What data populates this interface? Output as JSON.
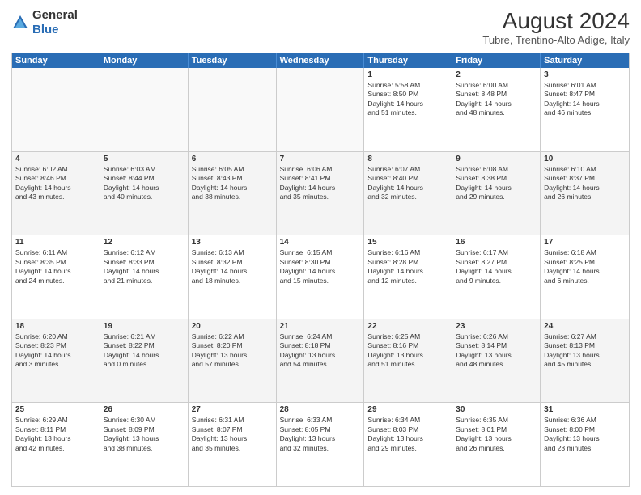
{
  "header": {
    "logo_general": "General",
    "logo_blue": "Blue",
    "month_year": "August 2024",
    "location": "Tubre, Trentino-Alto Adige, Italy"
  },
  "days_of_week": [
    "Sunday",
    "Monday",
    "Tuesday",
    "Wednesday",
    "Thursday",
    "Friday",
    "Saturday"
  ],
  "rows": [
    [
      {
        "day": "",
        "text": "",
        "empty": true
      },
      {
        "day": "",
        "text": "",
        "empty": true
      },
      {
        "day": "",
        "text": "",
        "empty": true
      },
      {
        "day": "",
        "text": "",
        "empty": true
      },
      {
        "day": "1",
        "text": "Sunrise: 5:58 AM\nSunset: 8:50 PM\nDaylight: 14 hours\nand 51 minutes."
      },
      {
        "day": "2",
        "text": "Sunrise: 6:00 AM\nSunset: 8:48 PM\nDaylight: 14 hours\nand 48 minutes."
      },
      {
        "day": "3",
        "text": "Sunrise: 6:01 AM\nSunset: 8:47 PM\nDaylight: 14 hours\nand 46 minutes."
      }
    ],
    [
      {
        "day": "4",
        "text": "Sunrise: 6:02 AM\nSunset: 8:46 PM\nDaylight: 14 hours\nand 43 minutes."
      },
      {
        "day": "5",
        "text": "Sunrise: 6:03 AM\nSunset: 8:44 PM\nDaylight: 14 hours\nand 40 minutes."
      },
      {
        "day": "6",
        "text": "Sunrise: 6:05 AM\nSunset: 8:43 PM\nDaylight: 14 hours\nand 38 minutes."
      },
      {
        "day": "7",
        "text": "Sunrise: 6:06 AM\nSunset: 8:41 PM\nDaylight: 14 hours\nand 35 minutes."
      },
      {
        "day": "8",
        "text": "Sunrise: 6:07 AM\nSunset: 8:40 PM\nDaylight: 14 hours\nand 32 minutes."
      },
      {
        "day": "9",
        "text": "Sunrise: 6:08 AM\nSunset: 8:38 PM\nDaylight: 14 hours\nand 29 minutes."
      },
      {
        "day": "10",
        "text": "Sunrise: 6:10 AM\nSunset: 8:37 PM\nDaylight: 14 hours\nand 26 minutes."
      }
    ],
    [
      {
        "day": "11",
        "text": "Sunrise: 6:11 AM\nSunset: 8:35 PM\nDaylight: 14 hours\nand 24 minutes."
      },
      {
        "day": "12",
        "text": "Sunrise: 6:12 AM\nSunset: 8:33 PM\nDaylight: 14 hours\nand 21 minutes."
      },
      {
        "day": "13",
        "text": "Sunrise: 6:13 AM\nSunset: 8:32 PM\nDaylight: 14 hours\nand 18 minutes."
      },
      {
        "day": "14",
        "text": "Sunrise: 6:15 AM\nSunset: 8:30 PM\nDaylight: 14 hours\nand 15 minutes."
      },
      {
        "day": "15",
        "text": "Sunrise: 6:16 AM\nSunset: 8:28 PM\nDaylight: 14 hours\nand 12 minutes."
      },
      {
        "day": "16",
        "text": "Sunrise: 6:17 AM\nSunset: 8:27 PM\nDaylight: 14 hours\nand 9 minutes."
      },
      {
        "day": "17",
        "text": "Sunrise: 6:18 AM\nSunset: 8:25 PM\nDaylight: 14 hours\nand 6 minutes."
      }
    ],
    [
      {
        "day": "18",
        "text": "Sunrise: 6:20 AM\nSunset: 8:23 PM\nDaylight: 14 hours\nand 3 minutes."
      },
      {
        "day": "19",
        "text": "Sunrise: 6:21 AM\nSunset: 8:22 PM\nDaylight: 14 hours\nand 0 minutes."
      },
      {
        "day": "20",
        "text": "Sunrise: 6:22 AM\nSunset: 8:20 PM\nDaylight: 13 hours\nand 57 minutes."
      },
      {
        "day": "21",
        "text": "Sunrise: 6:24 AM\nSunset: 8:18 PM\nDaylight: 13 hours\nand 54 minutes."
      },
      {
        "day": "22",
        "text": "Sunrise: 6:25 AM\nSunset: 8:16 PM\nDaylight: 13 hours\nand 51 minutes."
      },
      {
        "day": "23",
        "text": "Sunrise: 6:26 AM\nSunset: 8:14 PM\nDaylight: 13 hours\nand 48 minutes."
      },
      {
        "day": "24",
        "text": "Sunrise: 6:27 AM\nSunset: 8:13 PM\nDaylight: 13 hours\nand 45 minutes."
      }
    ],
    [
      {
        "day": "25",
        "text": "Sunrise: 6:29 AM\nSunset: 8:11 PM\nDaylight: 13 hours\nand 42 minutes."
      },
      {
        "day": "26",
        "text": "Sunrise: 6:30 AM\nSunset: 8:09 PM\nDaylight: 13 hours\nand 38 minutes."
      },
      {
        "day": "27",
        "text": "Sunrise: 6:31 AM\nSunset: 8:07 PM\nDaylight: 13 hours\nand 35 minutes."
      },
      {
        "day": "28",
        "text": "Sunrise: 6:33 AM\nSunset: 8:05 PM\nDaylight: 13 hours\nand 32 minutes."
      },
      {
        "day": "29",
        "text": "Sunrise: 6:34 AM\nSunset: 8:03 PM\nDaylight: 13 hours\nand 29 minutes."
      },
      {
        "day": "30",
        "text": "Sunrise: 6:35 AM\nSunset: 8:01 PM\nDaylight: 13 hours\nand 26 minutes."
      },
      {
        "day": "31",
        "text": "Sunrise: 6:36 AM\nSunset: 8:00 PM\nDaylight: 13 hours\nand 23 minutes."
      }
    ]
  ]
}
